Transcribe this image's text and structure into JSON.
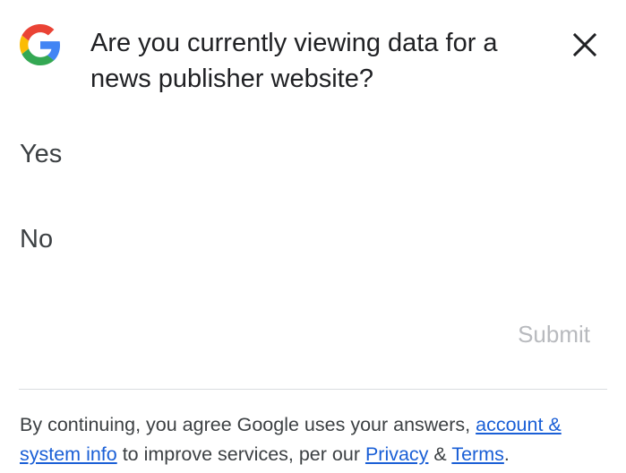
{
  "survey": {
    "question": "Are you currently viewing data for a news publisher website?",
    "options": [
      {
        "label": "Yes"
      },
      {
        "label": "No"
      }
    ],
    "submit_label": "Submit",
    "close_icon": "close-icon",
    "logo_icon": "google-g-logo"
  },
  "footer": {
    "text_before": "By continuing, you agree Google uses your answers, ",
    "link_account": "account & system info",
    "text_middle": " to improve services, per our ",
    "link_privacy": "Privacy",
    "text_amp": " & ",
    "link_terms": "Terms",
    "text_end": "."
  },
  "colors": {
    "google_blue": "#4285F4",
    "google_red": "#EA4335",
    "google_yellow": "#FBBC05",
    "google_green": "#34A853",
    "submit_disabled": "#b8babe",
    "link": "#1a5fd6",
    "divider": "#dadce0"
  }
}
